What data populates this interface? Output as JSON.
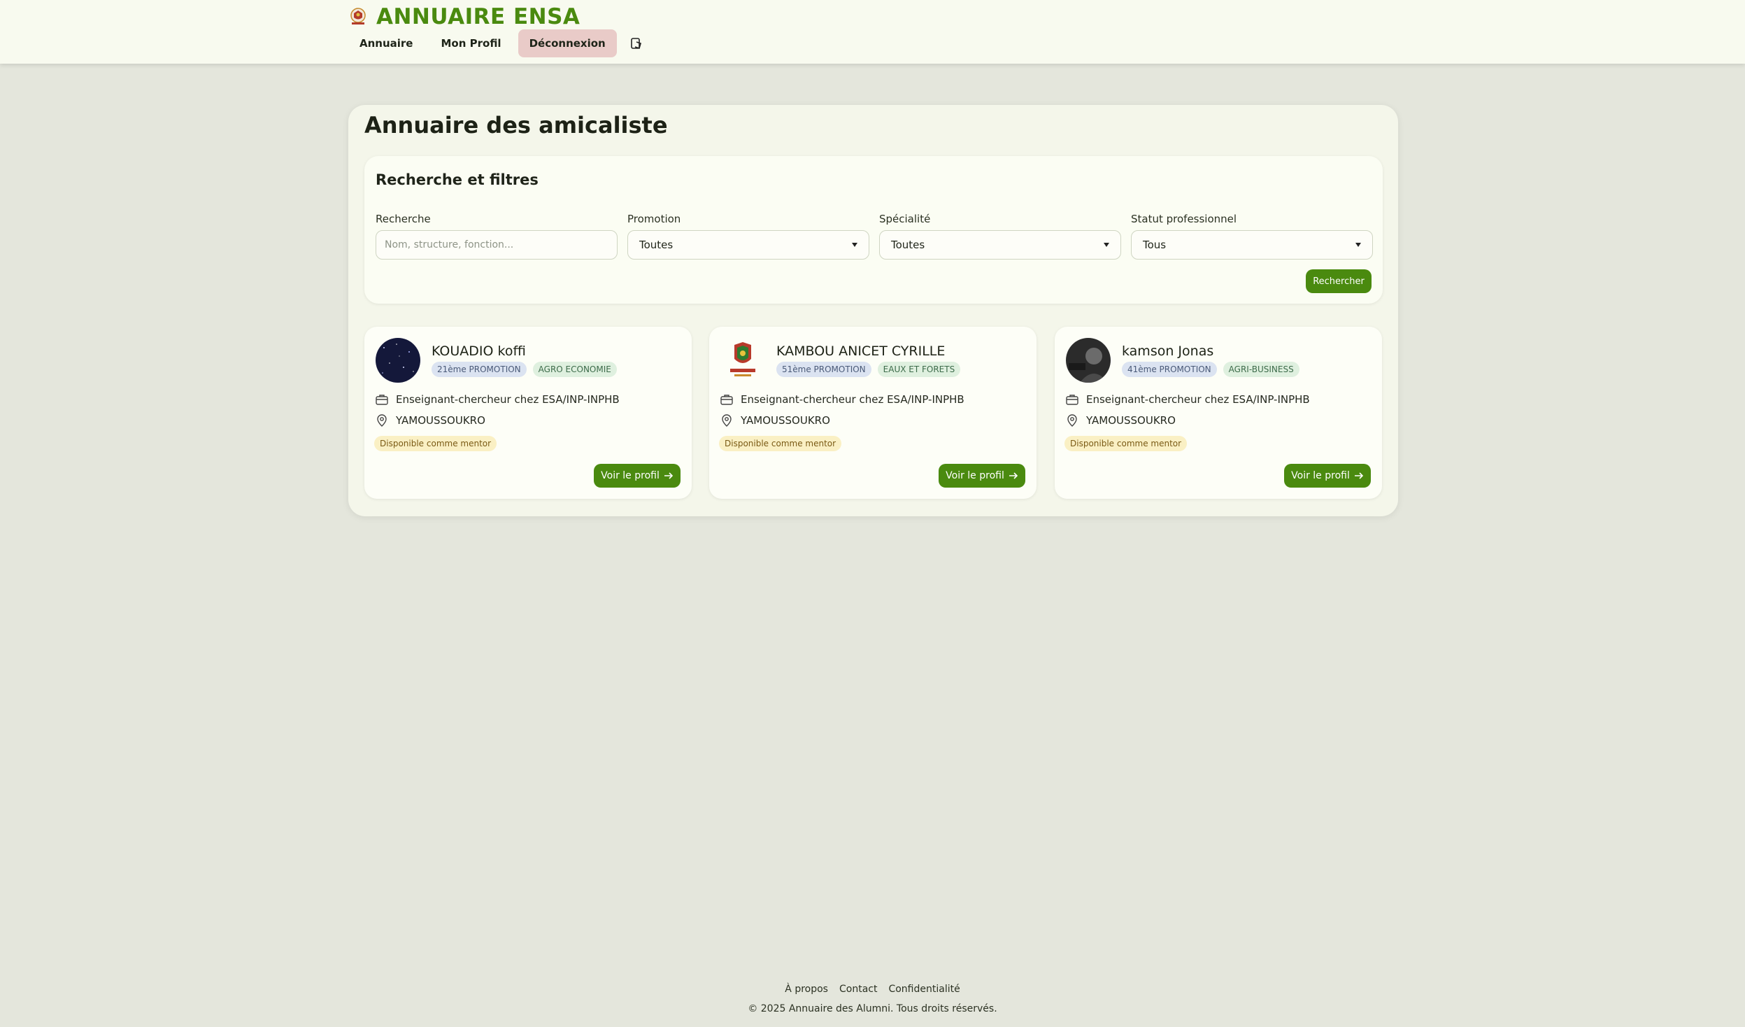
{
  "header": {
    "brand": "ANNUAIRE ENSA",
    "nav": [
      "Annuaire",
      "Mon Profil",
      "Déconnexion"
    ],
    "accent_color": "#4a8a0f"
  },
  "main": {
    "title": "Annuaire des amicaliste",
    "filters": {
      "title": "Recherche et filtres",
      "search": {
        "label": "Recherche",
        "placeholder": "Nom, structure, fonction..."
      },
      "promotion": {
        "label": "Promotion",
        "value": "Toutes"
      },
      "specialite": {
        "label": "Spécialité",
        "value": "Toutes"
      },
      "statut": {
        "label": "Statut professionnel",
        "value": "Tous"
      },
      "button": "Rechercher"
    },
    "cards": [
      {
        "name": "KOUADIO koffi",
        "promotion": "21ème PROMOTION",
        "specialite": "AGRO ECONOMIE",
        "job": "Enseignant-chercheur chez ESA/INP-INPHB",
        "city": "YAMOUSSOUKRO",
        "mentor": "Disponible comme mentor",
        "button": "Voir le profil"
      },
      {
        "name": "KAMBOU ANICET CYRILLE",
        "promotion": "51ème PROMOTION",
        "specialite": "EAUX ET FORETS",
        "job": "Enseignant-chercheur chez ESA/INP-INPHB",
        "city": "YAMOUSSOUKRO",
        "mentor": "Disponible comme mentor",
        "button": "Voir le profil"
      },
      {
        "name": "kamson Jonas",
        "promotion": "41ème PROMOTION",
        "specialite": "AGRI-BUSINESS",
        "job": "Enseignant-chercheur chez ESA/INP-INPHB",
        "city": "YAMOUSSOUKRO",
        "mentor": "Disponible comme mentor",
        "button": "Voir le profil"
      }
    ]
  },
  "footer": {
    "links": [
      "À propos",
      "Contact",
      "Confidentialité"
    ],
    "copyright": "© 2025 Annuaire des Alumni. Tous droits réservés."
  }
}
